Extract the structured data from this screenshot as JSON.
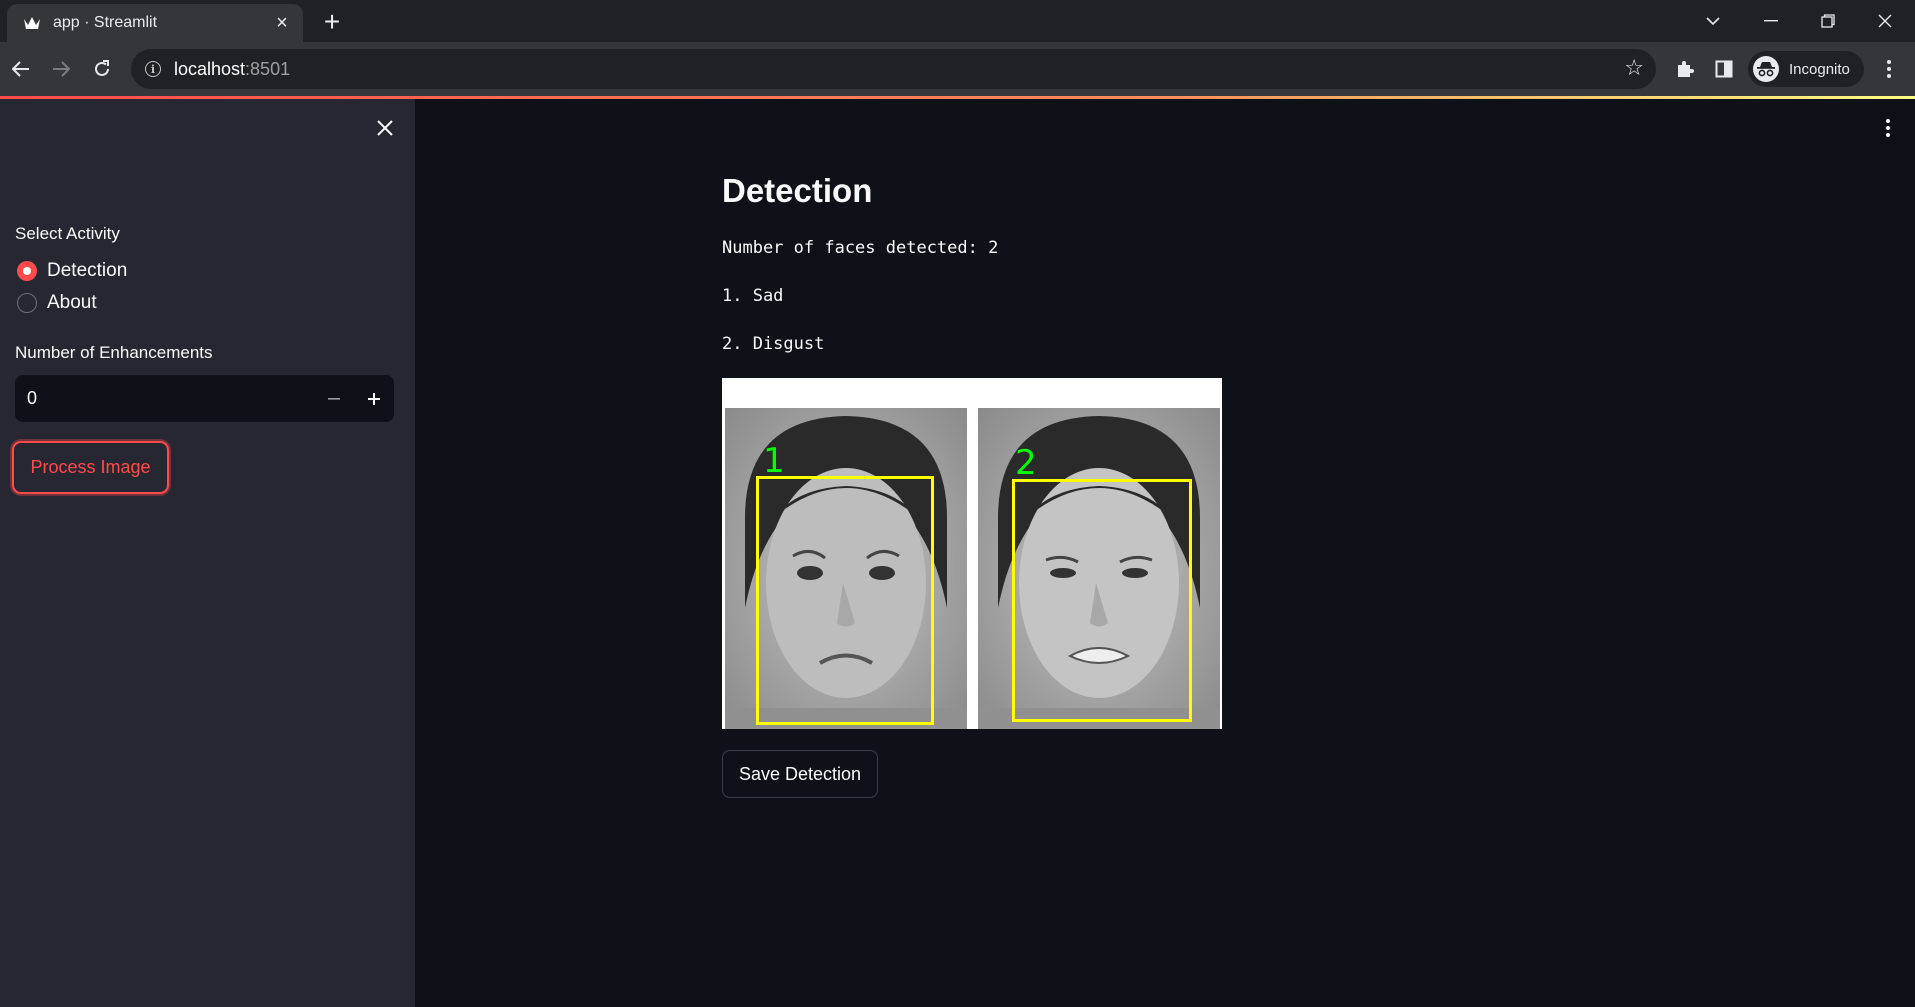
{
  "browser": {
    "tab_title": "app · Streamlit",
    "url_host": "localhost",
    "url_port": ":8501",
    "profile_label": "Incognito"
  },
  "sidebar": {
    "activity_label": "Select Activity",
    "activity_options": [
      {
        "label": "Detection",
        "selected": true
      },
      {
        "label": "About",
        "selected": false
      }
    ],
    "enhancements_label": "Number of Enhancements",
    "enhancements_value": "0",
    "process_button": "Process Image"
  },
  "main": {
    "title": "Detection",
    "faces_count_text": "Number of faces detected: 2",
    "results": [
      "1. Sad",
      "2. Disgust"
    ],
    "image": {
      "faces": [
        {
          "label": "1",
          "emotion": "sad"
        },
        {
          "label": "2",
          "emotion": "disgust"
        }
      ]
    },
    "save_button": "Save Detection"
  },
  "theme": {
    "primary": "#ff4b4b",
    "background": "#0e1117",
    "sidebar_bg": "#262730",
    "bbox_color": "#ffff00",
    "label_color": "#00ff00"
  }
}
